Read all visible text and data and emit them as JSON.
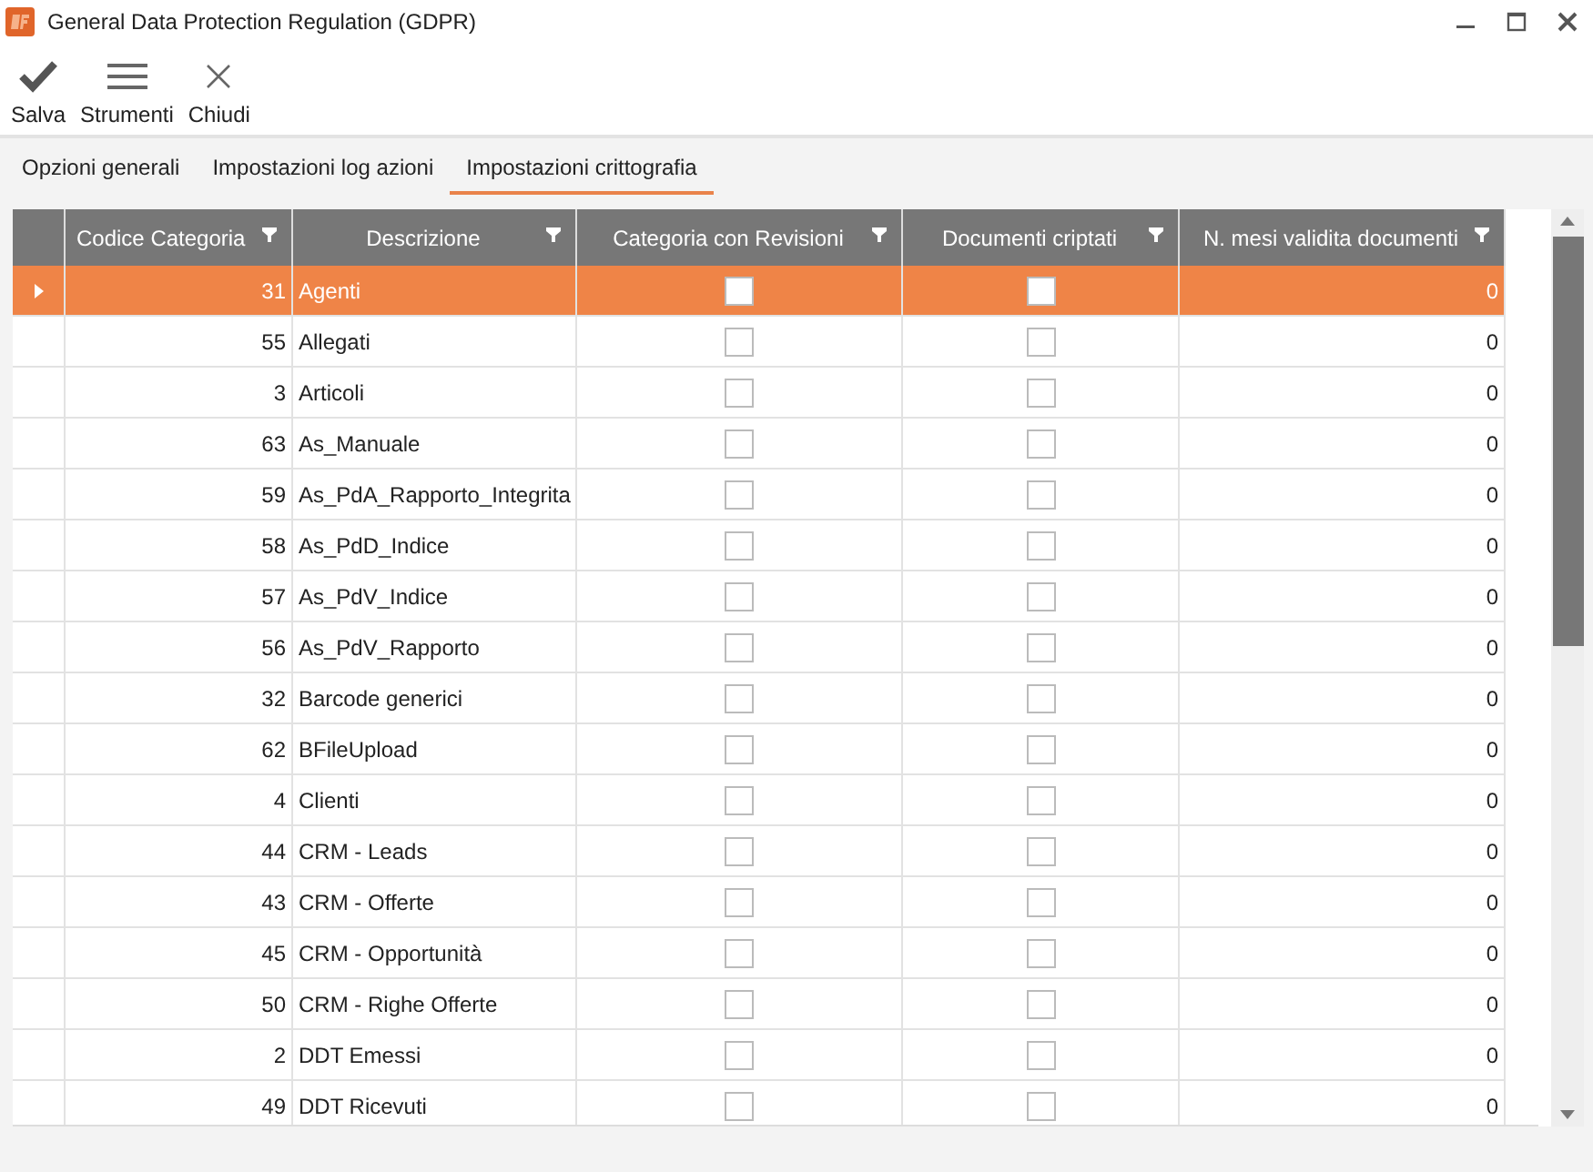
{
  "window": {
    "title": "General Data Protection Regulation (GDPR)"
  },
  "toolbar": [
    {
      "kind": "check",
      "label": "Salva"
    },
    {
      "kind": "menu",
      "label": "Strumenti"
    },
    {
      "kind": "close",
      "label": "Chiudi"
    }
  ],
  "tabs": [
    {
      "label": "Opzioni generali",
      "selected": false
    },
    {
      "label": "Impostazioni log azioni",
      "selected": false
    },
    {
      "label": "Impostazioni crittografia",
      "selected": true
    }
  ],
  "table": {
    "columns": [
      "Codice Categoria",
      "Descrizione",
      "Categoria con Revisioni",
      "Documenti criptati",
      "N. mesi validita documenti"
    ],
    "rows": [
      {
        "code": "31",
        "description": "Agenti",
        "revisions": false,
        "encrypted": false,
        "months": "0",
        "selected": true
      },
      {
        "code": "55",
        "description": "Allegati",
        "revisions": false,
        "encrypted": false,
        "months": "0",
        "selected": false
      },
      {
        "code": "3",
        "description": "Articoli",
        "revisions": false,
        "encrypted": false,
        "months": "0",
        "selected": false
      },
      {
        "code": "63",
        "description": "As_Manuale",
        "revisions": false,
        "encrypted": false,
        "months": "0",
        "selected": false
      },
      {
        "code": "59",
        "description": "As_PdA_Rapporto_Integrita",
        "revisions": false,
        "encrypted": false,
        "months": "0",
        "selected": false
      },
      {
        "code": "58",
        "description": "As_PdD_Indice",
        "revisions": false,
        "encrypted": false,
        "months": "0",
        "selected": false
      },
      {
        "code": "57",
        "description": "As_PdV_Indice",
        "revisions": false,
        "encrypted": false,
        "months": "0",
        "selected": false
      },
      {
        "code": "56",
        "description": "As_PdV_Rapporto",
        "revisions": false,
        "encrypted": false,
        "months": "0",
        "selected": false
      },
      {
        "code": "32",
        "description": "Barcode generici",
        "revisions": false,
        "encrypted": false,
        "months": "0",
        "selected": false
      },
      {
        "code": "62",
        "description": "BFileUpload",
        "revisions": false,
        "encrypted": false,
        "months": "0",
        "selected": false
      },
      {
        "code": "4",
        "description": "Clienti",
        "revisions": false,
        "encrypted": false,
        "months": "0",
        "selected": false
      },
      {
        "code": "44",
        "description": "CRM - Leads",
        "revisions": false,
        "encrypted": false,
        "months": "0",
        "selected": false
      },
      {
        "code": "43",
        "description": "CRM - Offerte",
        "revisions": false,
        "encrypted": false,
        "months": "0",
        "selected": false
      },
      {
        "code": "45",
        "description": "CRM - Opportunità",
        "revisions": false,
        "encrypted": false,
        "months": "0",
        "selected": false
      },
      {
        "code": "50",
        "description": "CRM - Righe Offerte",
        "revisions": false,
        "encrypted": false,
        "months": "0",
        "selected": false
      },
      {
        "code": "2",
        "description": "DDT Emessi",
        "revisions": false,
        "encrypted": false,
        "months": "0",
        "selected": false
      },
      {
        "code": "49",
        "description": "DDT Ricevuti",
        "revisions": false,
        "encrypted": false,
        "months": "0",
        "selected": false
      }
    ]
  }
}
